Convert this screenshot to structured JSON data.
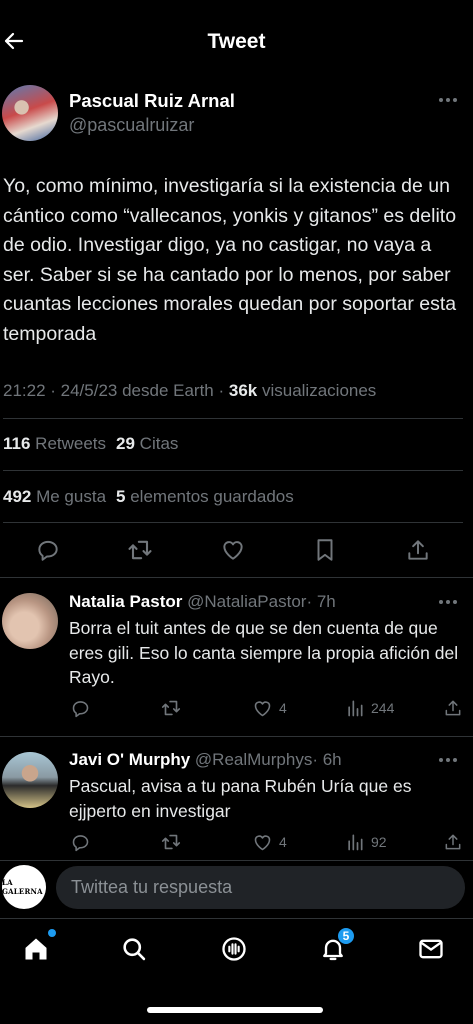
{
  "header": {
    "title": "Tweet"
  },
  "tweet": {
    "author_name": "Pascual Ruiz Arnal",
    "author_handle": "@pascualruizar",
    "text": "Yo, como mínimo, investigaría si la existencia de un cántico como “vallecanos, yonkis y gitanos” es delito de odio. Investigar digo, ya no castigar, no vaya a ser. Saber si se ha cantado por lo menos, por saber cuantas lecciones morales quedan por soportar esta temporada",
    "time": "21:22 · 24/5/23 desde Earth · ",
    "views_count": "36k",
    "views_label": " visualizaciones",
    "retweets_count": "116",
    "retweets_label": " Retweets",
    "quotes_count": "29",
    "quotes_label": " Citas",
    "likes_count": "492",
    "likes_label": " Me gusta",
    "bookmarks_count": "5",
    "bookmarks_label": " elementos guardados"
  },
  "replies": [
    {
      "name": "Natalia Pastor",
      "handle": "@NataliaPastor",
      "time": "· 7h",
      "text": "Borra el tuit antes de que se den cuenta de que eres gili. Eso lo canta siempre la propia afición del Rayo.",
      "likes": "4",
      "views": "244"
    },
    {
      "name": "Javi O' Murphy",
      "handle": "@RealMurphys",
      "time": "· 6h",
      "text": "Pascual, avisa a tu pana Rubén Uría que es ejjperto en investigar",
      "likes": "4",
      "views": "92"
    }
  ],
  "compose": {
    "avatar_label": "LA GALERNA",
    "placeholder": "Twittea tu respuesta"
  },
  "nav": {
    "notifications_badge": "5"
  },
  "colors": {
    "accent": "#1d9bf0",
    "muted": "#71767b",
    "background": "#000000"
  }
}
